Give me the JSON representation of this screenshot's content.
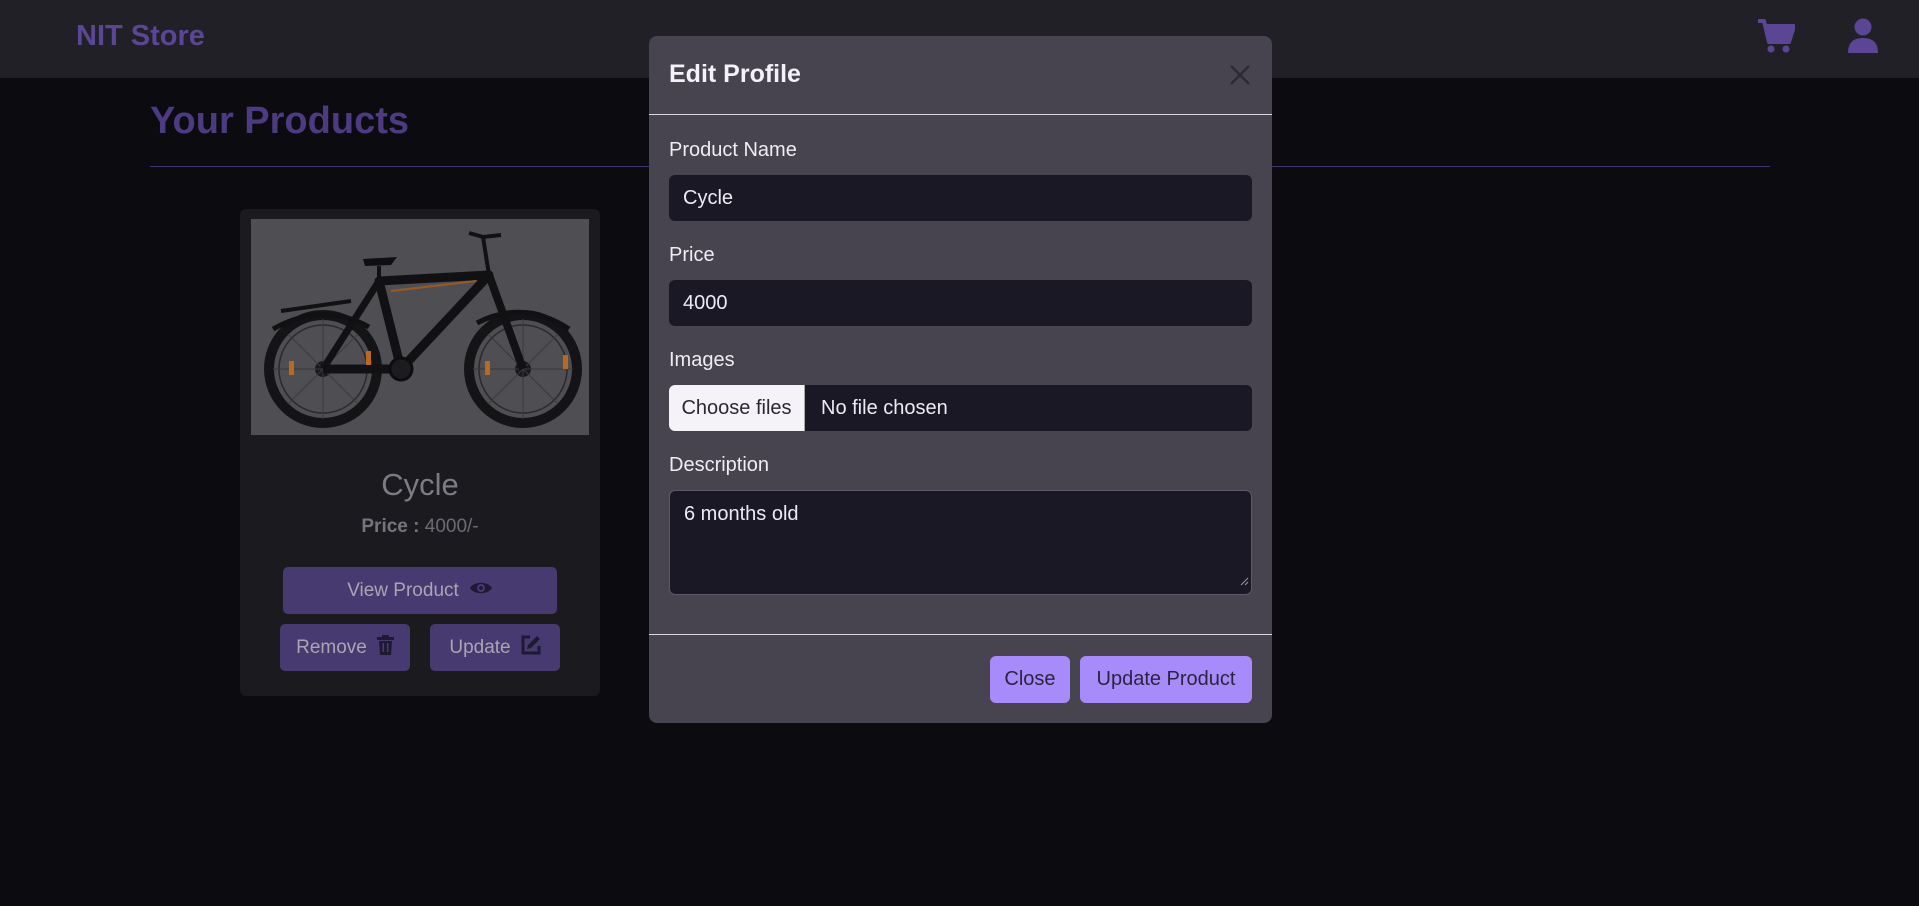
{
  "navbar": {
    "brand": "NIT Store",
    "cart_icon": "cart-icon",
    "user_icon": "user-icon"
  },
  "page": {
    "title": "Your Products"
  },
  "product_card": {
    "image_icon": "bicycle-image",
    "name": "Cycle",
    "price_label": "Price :",
    "price_value": "4000/-",
    "view_label": "View Product",
    "remove_label": "Remove",
    "update_label": "Update"
  },
  "modal": {
    "title": "Edit Profile",
    "fields": {
      "name_label": "Product Name",
      "name_value": "Cycle",
      "price_label": "Price",
      "price_value": "4000",
      "images_label": "Images",
      "file_button": "Choose files",
      "file_status": "No file chosen",
      "description_label": "Description",
      "description_value": "6 months old"
    },
    "close_label": "Close",
    "submit_label": "Update Product"
  },
  "colors": {
    "accent": "#a78bfa",
    "brand": "#5b4696",
    "modal_bg": "#47434f",
    "input_bg": "#1b1825",
    "page_bg": "#0c0b10"
  }
}
